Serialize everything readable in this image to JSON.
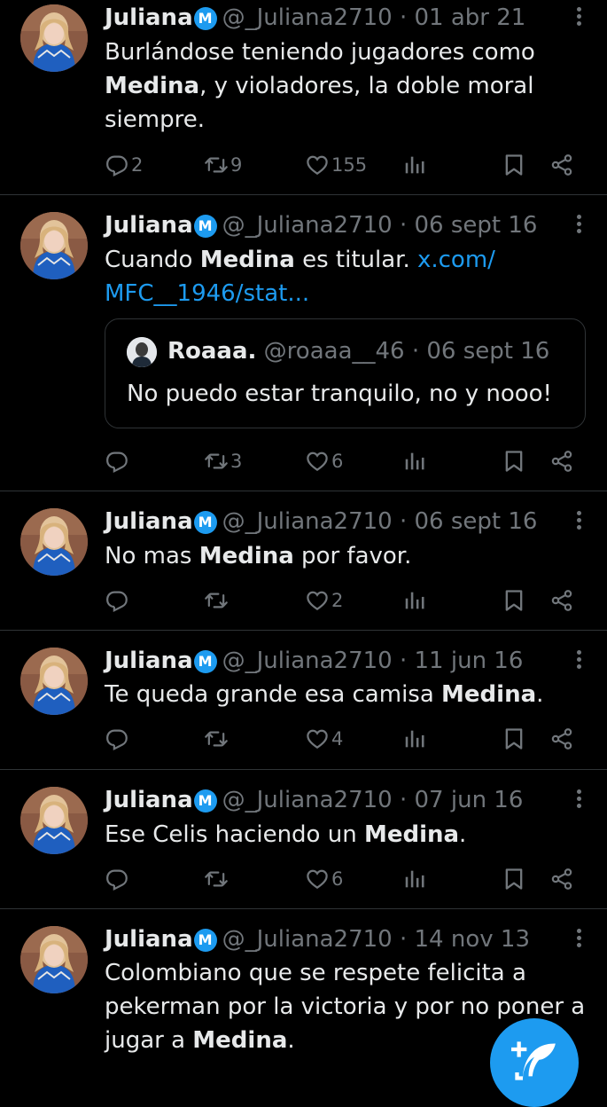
{
  "tweets": [
    {
      "name": "Juliana",
      "badge": "M",
      "handle": "@_Juliana2710",
      "date": "· 01 abr 21",
      "text_parts": [
        {
          "t": "Burlándose teniendo jugadores como ",
          "b": false
        },
        {
          "t": "Medina",
          "b": true
        },
        {
          "t": ", y violadores, la doble moral siempre.",
          "b": false
        }
      ],
      "replies": "2",
      "retweets": "9",
      "likes": "155"
    },
    {
      "name": "Juliana",
      "badge": "M",
      "handle": "@_Juliana2710",
      "date": "· 06 sept 16",
      "text_parts": [
        {
          "t": "Cuando ",
          "b": false
        },
        {
          "t": "Medina",
          "b": true
        },
        {
          "t": " es titular. ",
          "b": false
        }
      ],
      "link": "x.com/\nMFC__1946/stat...",
      "quote": {
        "name": "Roaaa.",
        "handle": "@roaaa__46",
        "date": "· 06 sept 16",
        "text": "No puedo estar tranquilo, no y nooo!"
      },
      "replies": "",
      "retweets": "3",
      "likes": "6"
    },
    {
      "name": "Juliana",
      "badge": "M",
      "handle": "@_Juliana2710",
      "date": "· 06 sept 16",
      "text_parts": [
        {
          "t": "No mas ",
          "b": false
        },
        {
          "t": "Medina",
          "b": true
        },
        {
          "t": " por favor.",
          "b": false
        }
      ],
      "replies": "",
      "retweets": "",
      "likes": "2"
    },
    {
      "name": "Juliana",
      "badge": "M",
      "handle": "@_Juliana2710",
      "date": "· 11 jun 16",
      "text_parts": [
        {
          "t": "Te queda grande esa camisa ",
          "b": false
        },
        {
          "t": "Medina",
          "b": true
        },
        {
          "t": ".",
          "b": false
        }
      ],
      "replies": "",
      "retweets": "",
      "likes": "4"
    },
    {
      "name": "Juliana",
      "badge": "M",
      "handle": "@_Juliana2710",
      "date": "· 07 jun 16",
      "text_parts": [
        {
          "t": "Ese Celis haciendo un ",
          "b": false
        },
        {
          "t": "Medina",
          "b": true
        },
        {
          "t": ".",
          "b": false
        }
      ],
      "replies": "",
      "retweets": "",
      "likes": "6"
    },
    {
      "name": "Juliana",
      "badge": "M",
      "handle": "@_Juliana2710",
      "date": "· 14 nov 13",
      "text_parts": [
        {
          "t": "Colombiano que se respete felicita a pekerman por la victoria y por no poner a jugar a ",
          "b": false
        },
        {
          "t": "Medina",
          "b": true
        },
        {
          "t": ".",
          "b": false
        }
      ]
    }
  ],
  "icons": {
    "reply": "reply-icon",
    "retweet": "retweet-icon",
    "like": "heart-icon",
    "views": "views-icon",
    "bookmark": "bookmark-icon",
    "share": "share-icon",
    "more": "more-icon",
    "compose": "compose-icon"
  },
  "colors": {
    "background": "#000000",
    "text": "#e7e9ea",
    "muted": "#71767b",
    "accent": "#1d9bf0",
    "divider": "#2f3336"
  }
}
